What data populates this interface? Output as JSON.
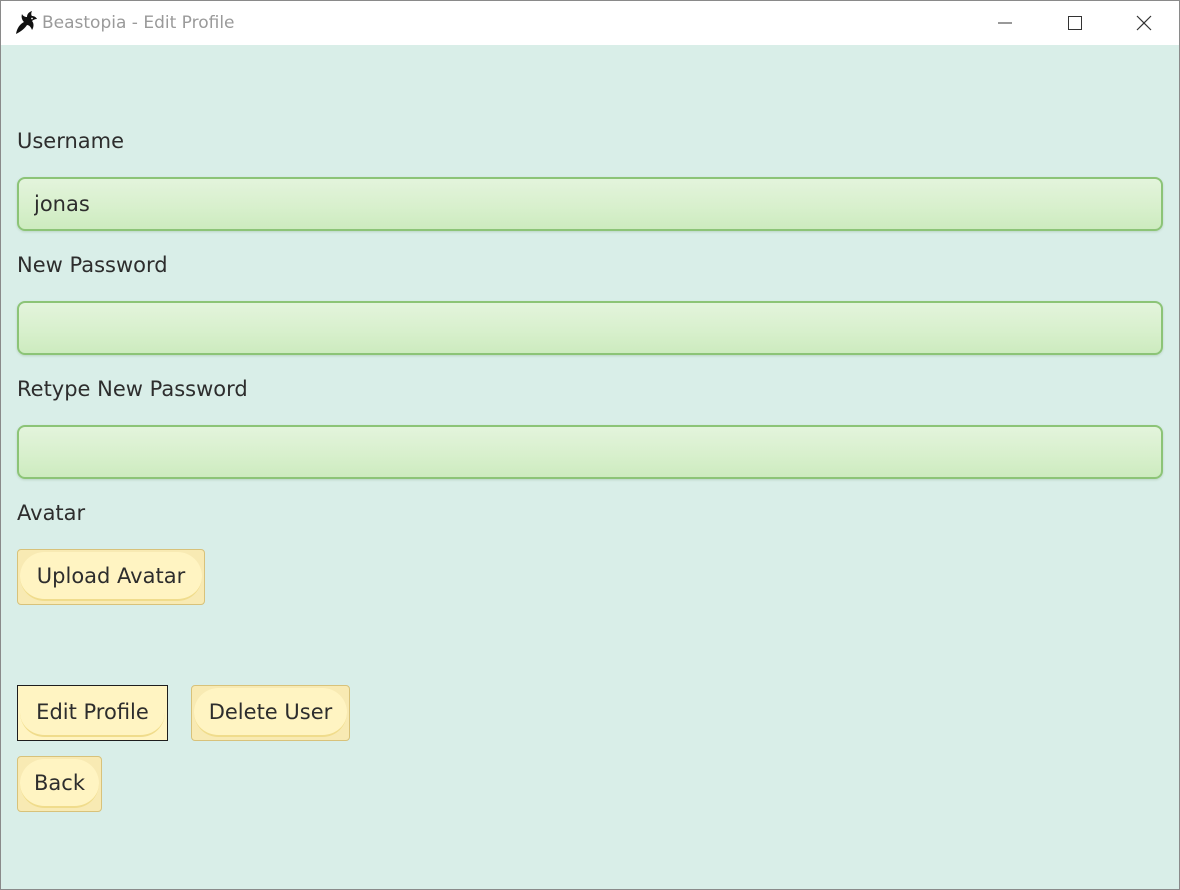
{
  "window": {
    "title": "Beastopia - Edit Profile",
    "app_icon": "dragon-icon",
    "controls": {
      "minimize_icon": "minimize-icon",
      "maximize_icon": "maximize-icon",
      "close_icon": "close-icon"
    }
  },
  "form": {
    "username": {
      "label": "Username",
      "value": "jonas"
    },
    "new_password": {
      "label": "New Password",
      "value": ""
    },
    "retype_password": {
      "label": "Retype New Password",
      "value": ""
    },
    "avatar": {
      "label": "Avatar",
      "upload_button": "Upload Avatar"
    }
  },
  "actions": {
    "edit_profile": "Edit Profile",
    "delete_user": "Delete User",
    "back": "Back"
  },
  "colors": {
    "background": "#d9eee8",
    "field_fill": "#d8f0cd",
    "field_border": "#8cc477",
    "button_fill": "#fff4c2",
    "button_border": "#d8c27a"
  }
}
